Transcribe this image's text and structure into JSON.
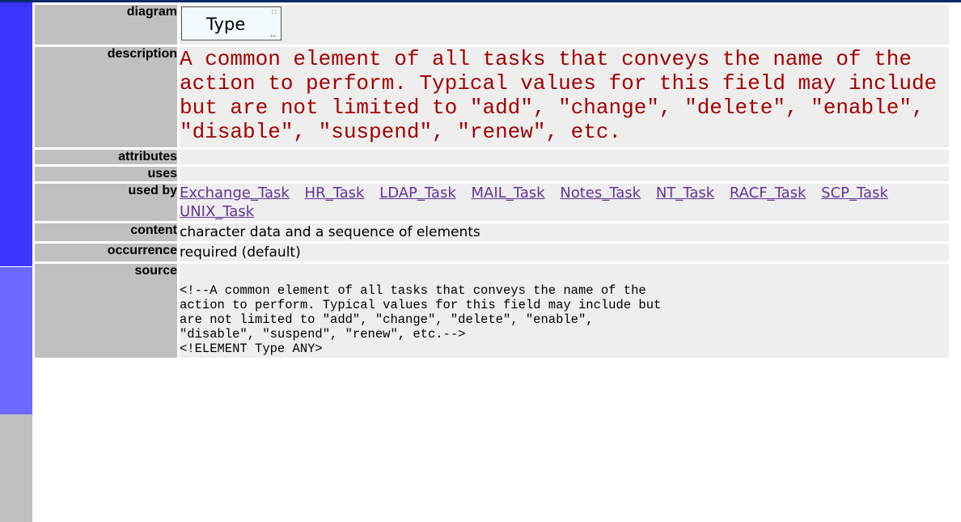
{
  "rows": {
    "diagram": {
      "label": "diagram",
      "box_name": "Type"
    },
    "description": {
      "label": "description",
      "text": "A common element of all tasks that conveys the name of the action to perform. Typical values for this field may include but are not limited to \"add\", \"change\", \"delete\", \"enable\", \"disable\", \"suspend\", \"renew\", etc."
    },
    "attributes": {
      "label": "attributes",
      "value": ""
    },
    "uses": {
      "label": "uses",
      "value": ""
    },
    "used_by": {
      "label": "used by",
      "links": [
        "Exchange_Task",
        "HR_Task",
        "LDAP_Task",
        "MAIL_Task",
        "Notes_Task",
        "NT_Task",
        "RACF_Task",
        "SCP_Task",
        "UNIX_Task"
      ]
    },
    "content": {
      "label": "content",
      "value": "character data and a sequence of elements"
    },
    "occurrence": {
      "label": "occurrence",
      "value": "required (default)"
    },
    "source": {
      "label": "source",
      "code": "<!--A common element of all tasks that conveys the name of the\naction to perform. Typical values for this field may include but\nare not limited to \"add\", \"change\", \"delete\", \"enable\",\n\"disable\", \"suspend\", \"renew\", etc.-->\n<!ELEMENT Type ANY>"
    }
  },
  "colors": {
    "sidebar_primary": "#3a35ff",
    "sidebar_secondary": "#6d68ff",
    "description_text": "#a50000",
    "link": "#663399"
  }
}
